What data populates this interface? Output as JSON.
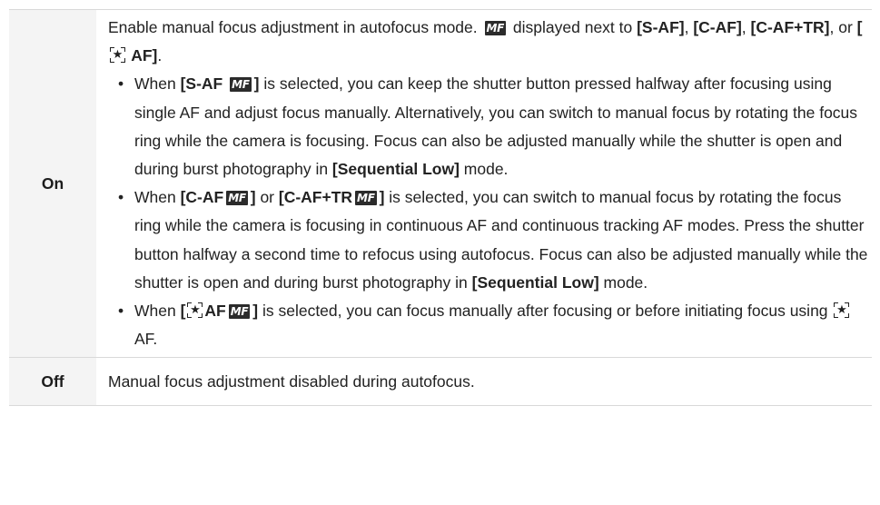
{
  "table": {
    "rows": [
      {
        "label": "On",
        "intro": {
          "t1": "Enable manual focus adjustment in autofocus mode. ",
          "t2": " displayed next to ",
          "b1": "[S-AF]",
          "t3": ", ",
          "b2": "[C-AF]",
          "t4": ", ",
          "b3": "[C-AF+TR]",
          "t5": ", or ",
          "b4a": "[",
          "b4b": " AF]",
          "t6": "."
        },
        "bullets": [
          {
            "t1": "When ",
            "b1a": "[S-AF ",
            "b1b": "]",
            "t2": " is selected, you can keep the shutter button pressed halfway after focusing using single AF and adjust focus manually. Alternatively, you can switch to manual focus by rotating the focus ring while the camera is focusing. Focus can also be adjusted manually while the shutter is open and during burst photography in ",
            "b2": "[Sequential Low]",
            "t3": " mode."
          },
          {
            "t1": "When ",
            "b1a": "[C-AF",
            "b1b": "]",
            "t2": " or ",
            "b2a": "[C-AF+TR",
            "b2b": "]",
            "t3": " is selected, you can switch to manual focus by rotating the focus ring while the camera is focusing in continuous AF and continuous tracking AF modes. Press the shutter button halfway a second time to refocus using autofocus. Focus can also be adjusted manually while the shutter is open and during burst photography in ",
            "b3": "[Sequential Low]",
            "t4": " mode."
          },
          {
            "t1": "When ",
            "b1a": "[",
            "b1b": "AF",
            "b1c": "]",
            "t2": " is selected, you can focus manually after focusing or before initiating focus using ",
            "t3": " AF."
          }
        ]
      },
      {
        "label": "Off",
        "desc": "Manual focus adjustment disabled during autofocus."
      }
    ]
  },
  "icons": {
    "mf_text": "MF",
    "mf_icon": "mf-icon",
    "face_icon": "face-priority-icon",
    "face_glyph": "★"
  },
  "colors": {
    "label_bg": "#f4f4f4",
    "border": "#d9d9d9",
    "text": "#222222",
    "mf_bg": "#2b2b2b"
  }
}
